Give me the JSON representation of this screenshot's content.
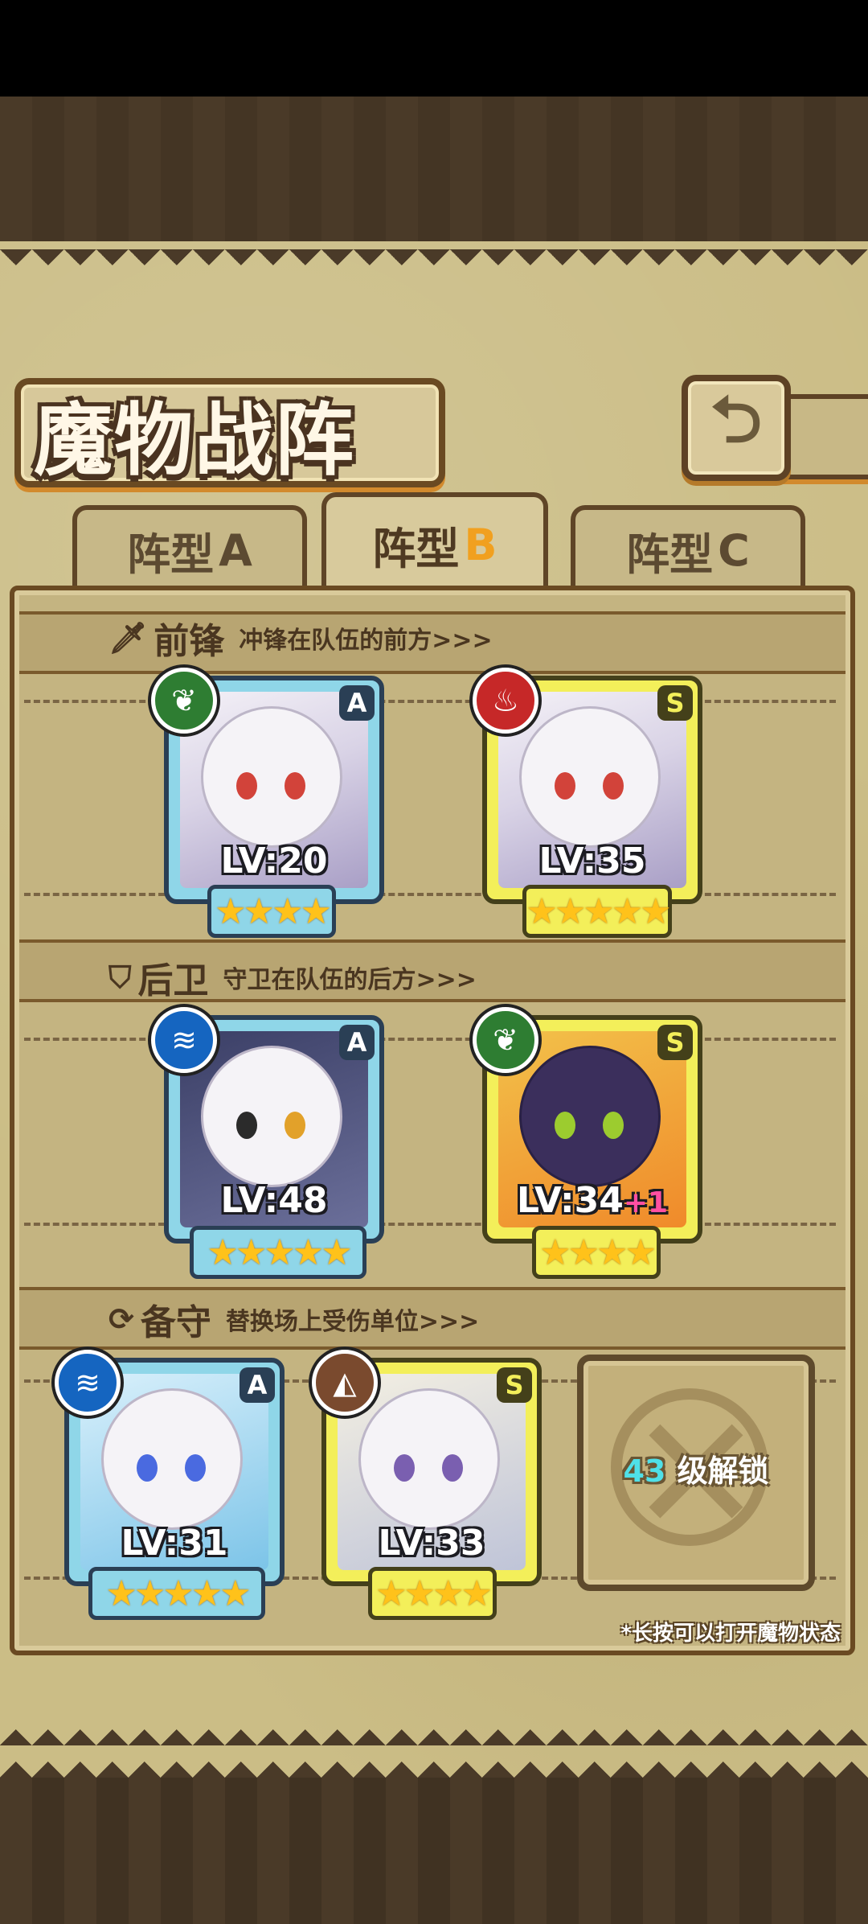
{
  "title": "魔物战阵",
  "back_icon": "back-arrow-icon",
  "tabs": [
    {
      "prefix": "阵型",
      "suffix": "A",
      "active": false
    },
    {
      "prefix": "阵型",
      "suffix": "B",
      "active": true
    },
    {
      "prefix": "阵型",
      "suffix": "C",
      "active": false
    }
  ],
  "sections": {
    "front": {
      "name": "前锋",
      "desc": "冲锋在队伍的前方>>>",
      "icon": "sword-icon"
    },
    "rear": {
      "name": "后卫",
      "desc": "守卫在队伍的后方>>>",
      "icon": "shield-icon"
    },
    "reserve": {
      "name": "备守",
      "desc": "替换场上受伤单位>>>",
      "icon": "swap-icon"
    }
  },
  "units": {
    "front1": {
      "rank": "A",
      "level": "LV:20",
      "stars": "★★★★",
      "element": "leaf-element-icon"
    },
    "front2": {
      "rank": "S",
      "level": "LV:35",
      "stars": "★★★★★",
      "element": "fire-element-icon"
    },
    "rear1": {
      "rank": "A",
      "level": "LV:48",
      "stars": "★★★★★",
      "element": "water-element-icon"
    },
    "rear2": {
      "rank": "S",
      "level": "LV:34",
      "plus": "+1",
      "stars": "★★★★",
      "element": "leaf-element-icon"
    },
    "reserve1": {
      "rank": "A",
      "level": "LV:31",
      "stars": "★★★★★",
      "element": "water-element-icon"
    },
    "reserve2": {
      "rank": "S",
      "level": "LV:33",
      "stars": "★★★★",
      "element": "earth-element-icon"
    }
  },
  "locked_slot": {
    "level": "43",
    "text": "级解锁"
  },
  "hint": "*长按可以打开魔物状态",
  "colors": {
    "parchment": "#cbbd86",
    "frame": "#6a4a22",
    "rank_a": "#8fd6e8",
    "rank_s": "#f3ef5a",
    "accent": "#f1a01f"
  }
}
